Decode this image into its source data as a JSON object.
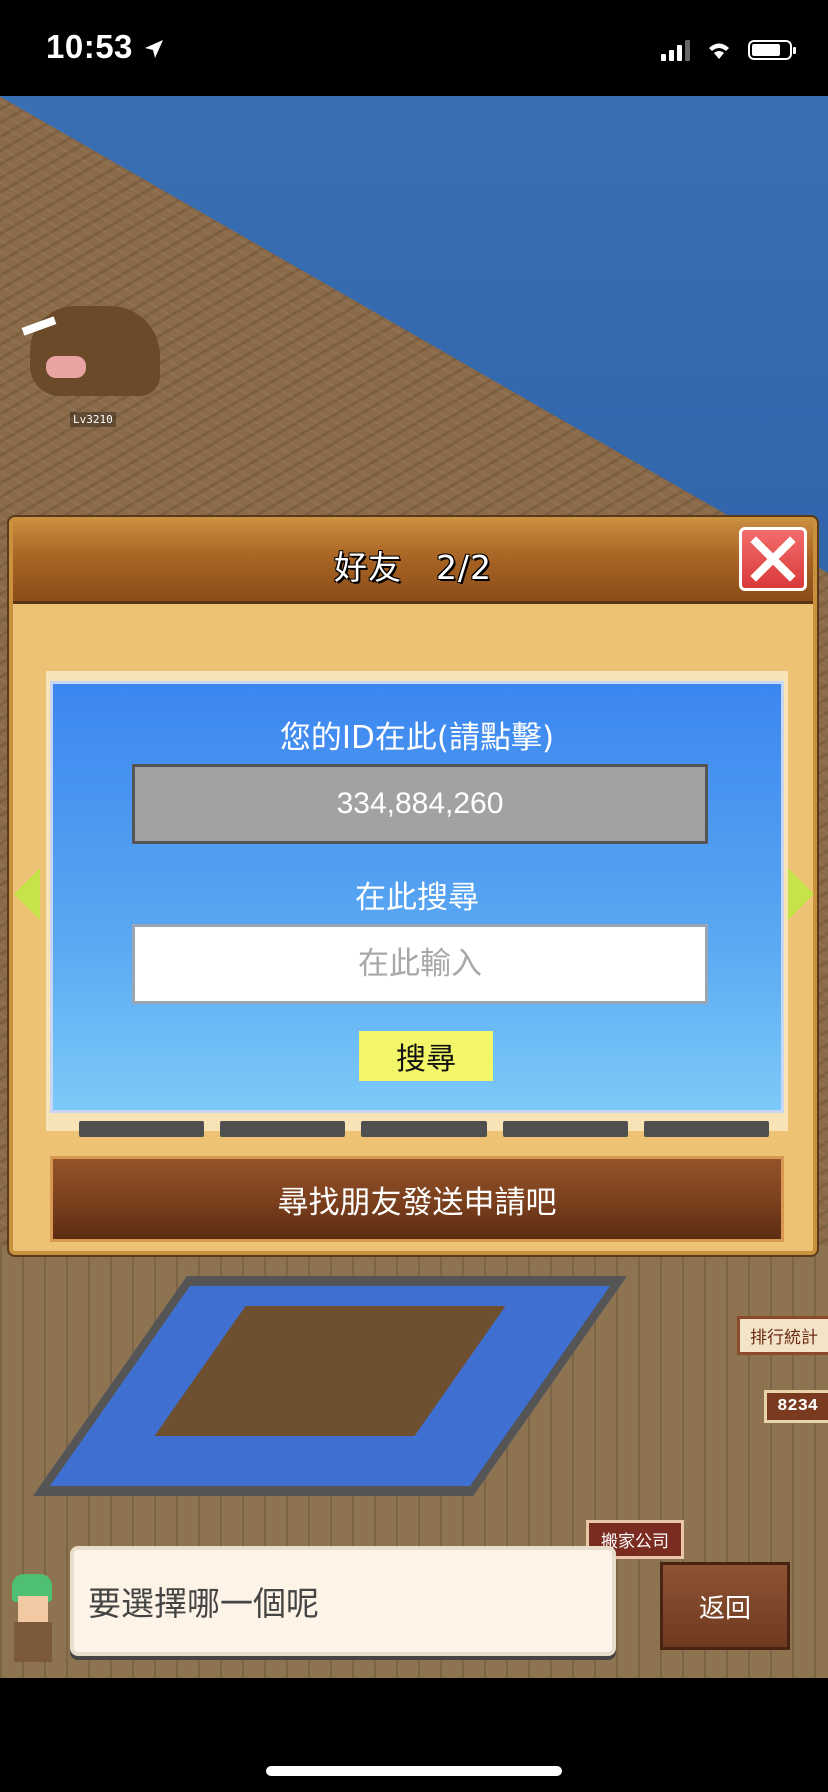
{
  "status_bar": {
    "time": "10:53"
  },
  "world": {
    "monster_label": "Lv3210"
  },
  "friends_dialog": {
    "title": "好友　2/2",
    "id_label": "您的ID在此(請點擊)",
    "id_value": "334,884,260",
    "search_label": "在此搜尋",
    "search_placeholder": "在此輸入",
    "search_button": "搜尋",
    "send_request_button": "尋找朋友發送申請吧"
  },
  "side_tags": {
    "ranking": "排行統計",
    "score": "8234",
    "moving_company": "搬家公司"
  },
  "prompt": {
    "message": "要選擇哪一個呢",
    "back_button": "返回"
  },
  "colors": {
    "panel_blue": "#3c86f0",
    "close_red": "#e04848",
    "search_yellow": "#f4f66a"
  }
}
